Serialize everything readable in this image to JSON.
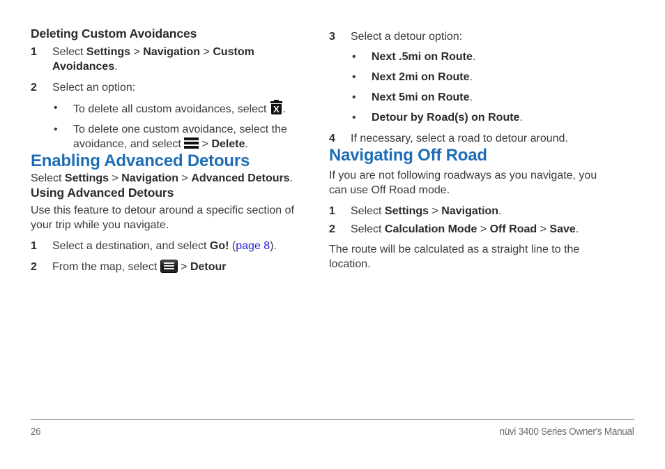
{
  "page": {
    "number": "26",
    "manual_title": "nüvi 3400 Series Owner's Manual",
    "heading_color": "#1f6eb5",
    "link_color": "#2222dd",
    "body_color": "#3a3a3a"
  },
  "left_column": {
    "section1": {
      "heading": "Deleting Custom Avoidances",
      "step1": {
        "num": "1",
        "text_a": "Select ",
        "bold_a": "Settings",
        "sep_a": " > ",
        "bold_b": "Navigation",
        "sep_b": " > ",
        "bold_c": "Custom Avoidances",
        "text_end": "."
      },
      "step2": {
        "num": "2",
        "text": "Select an option:"
      },
      "bullet1": {
        "dot": "•",
        "text": "To delete all custom avoidances, select ",
        "icon": "trash-x-icon",
        "text_end": "."
      },
      "bullet2": {
        "dot": "•",
        "text": "To delete one custom avoidance, select the avoidance, and select ",
        "icon": "menu-bars-icon",
        "sep": " > ",
        "bold": "Delete",
        "text_end": "."
      }
    },
    "section2": {
      "heading": "Enabling Advanced Detours",
      "para": {
        "text_a": "Select ",
        "bold_a": "Settings",
        "sep_a": " > ",
        "bold_b": "Navigation",
        "sep_b": " > ",
        "bold_c": "Advanced Detours",
        "text_end": "."
      }
    },
    "section3": {
      "heading": "Using Advanced Detours",
      "para": "Use this feature to detour around a specific section of your trip while you navigate.",
      "step1": {
        "num": "1",
        "text_a": "Select a destination, and select ",
        "bold_a": "Go!",
        "text_b": " (",
        "link": "page 8",
        "text_end": ")."
      },
      "step2": {
        "num": "2",
        "text_a": "From the map, select ",
        "icon": "menu-button-icon",
        "sep": " > ",
        "bold_a": "Detour"
      }
    }
  },
  "right_column": {
    "section1": {
      "step3": {
        "num": "3",
        "text": "Select a detour option:"
      },
      "bullets": [
        {
          "dot": "•",
          "bold": "Next .5mi on Route",
          "text_end": "."
        },
        {
          "dot": "•",
          "bold": "Next 2mi on Route",
          "text_end": "."
        },
        {
          "dot": "•",
          "bold": "Next 5mi on Route",
          "text_end": "."
        },
        {
          "dot": "•",
          "bold": "Detour by Road(s) on Route",
          "text_end": "."
        }
      ],
      "step4": {
        "num": "4",
        "text": "If necessary, select a road to detour around."
      }
    },
    "section2": {
      "heading": "Navigating Off Road",
      "para": "If you are not following roadways as you navigate, you can use Off Road mode.",
      "step1": {
        "num": "1",
        "text_a": "Select ",
        "bold_a": "Settings",
        "sep_a": " > ",
        "bold_b": "Navigation",
        "text_end": "."
      },
      "step2": {
        "num": "2",
        "text_a": "Select ",
        "bold_a": "Calculation Mode",
        "sep_a": " > ",
        "bold_b": "Off Road",
        "sep_b": " > ",
        "bold_c": "Save",
        "text_end": "."
      },
      "note": "The route will be calculated as a straight line to the location."
    }
  },
  "icons": {
    "trash_x_letter": "X"
  }
}
